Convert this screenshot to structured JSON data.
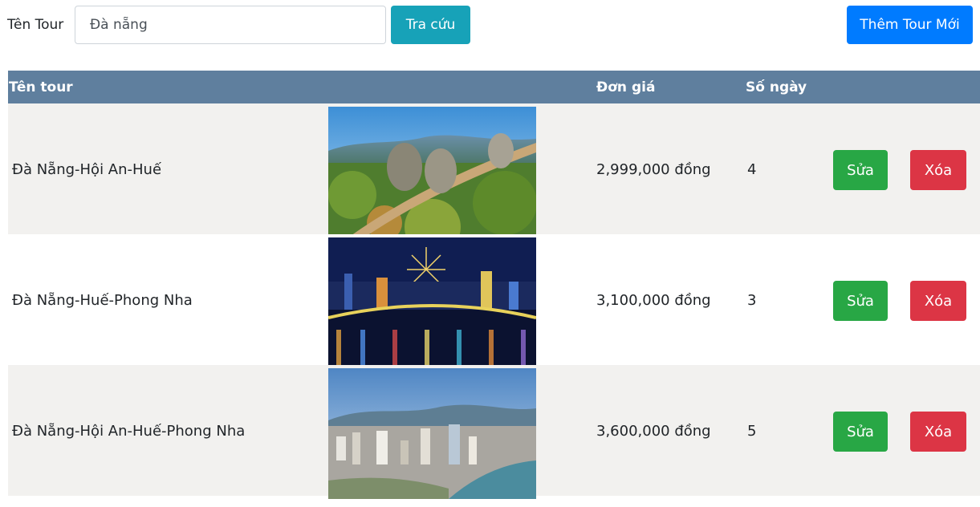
{
  "search": {
    "label": "Tên Tour",
    "value": "Đà nẵng",
    "button_label": "Tra cứu"
  },
  "add_button_label": "Thêm Tour Mới",
  "table": {
    "headers": {
      "name": "Tên tour",
      "price": "Đơn giá",
      "days": "Số ngày"
    },
    "rows": [
      {
        "name": "Đà Nẵng-Hội An-Huế",
        "price": "2,999,000 đồng",
        "days": "4",
        "edit_label": "Sửa",
        "delete_label": "Xóa",
        "image": "golden-bridge-hands-photo"
      },
      {
        "name": "Đà Nẵng-Huế-Phong Nha",
        "price": "3,100,000 đồng",
        "days": "3",
        "edit_label": "Sửa",
        "delete_label": "Xóa",
        "image": "night-fireworks-city-photo"
      },
      {
        "name": "Đà Nẵng-Hội An-Huế-Phong Nha",
        "price": "3,600,000 đồng",
        "days": "5",
        "edit_label": "Sửa",
        "delete_label": "Xóa",
        "image": "city-river-aerial-photo"
      }
    ]
  },
  "colors": {
    "header_bg": "#5f7f9e",
    "search_button": "#17a2b8",
    "add_button": "#007bff",
    "edit_button": "#28a745",
    "delete_button": "#dc3545",
    "striped_row": "#f2f1ef"
  }
}
